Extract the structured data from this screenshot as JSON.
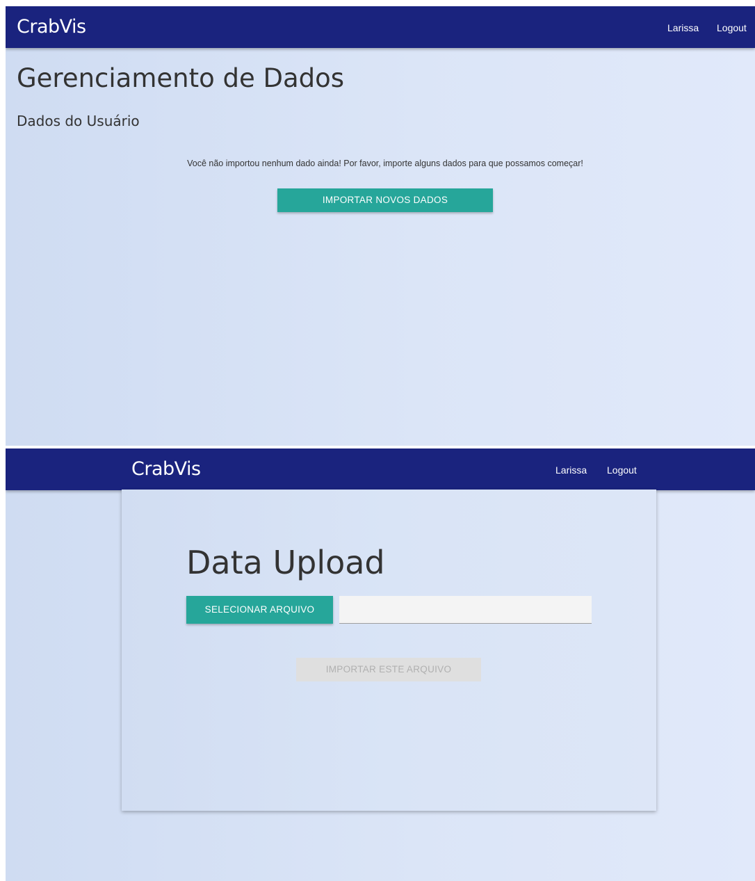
{
  "screens": {
    "management": {
      "navbar": {
        "brand": "CrabVis",
        "user": "Larissa",
        "logout": "Logout"
      },
      "title": "Gerenciamento de Dados",
      "subtitle": "Dados do Usuário",
      "empty_message": "Você não importou nenhum dado ainda! Por favor, importe alguns dados para que possamos começar!",
      "import_button": "IMPORTAR NOVOS DADOS"
    },
    "upload": {
      "navbar": {
        "brand": "CrabVis",
        "user": "Larissa",
        "logout": "Logout"
      },
      "title": "Data Upload",
      "select_button": "SELECIONAR ARQUIVO",
      "file_path_value": "",
      "import_file_button": "IMPORTAR ESTE ARQUIVO"
    }
  },
  "colors": {
    "navbar": "#1a237e",
    "accent": "#26a69a",
    "background": "#d9e4f6"
  }
}
